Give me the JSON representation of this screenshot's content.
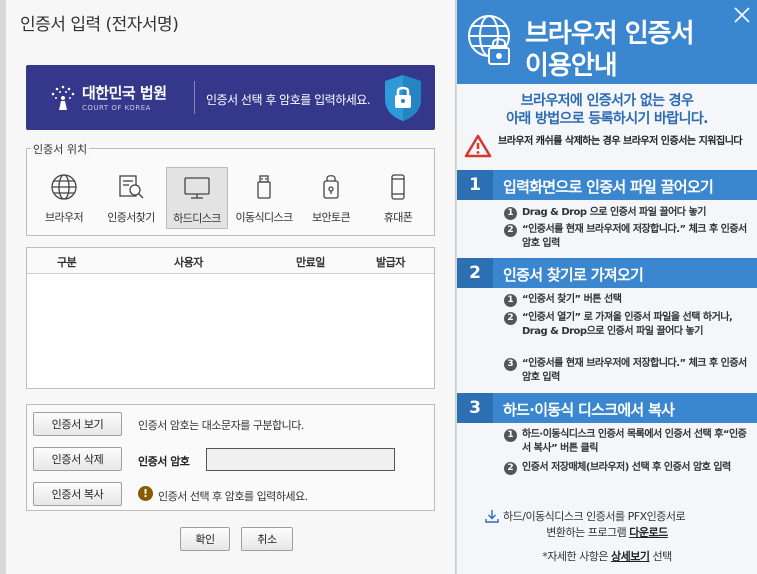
{
  "dialog": {
    "title": "인증서 입력 (전자서명)",
    "banner": {
      "org_name": "대한민국 법원",
      "org_en": "COURT OF KOREA",
      "message": "인증서 선택 후 암호를 입력하세요."
    },
    "location": {
      "legend": "인증서 위치",
      "items": [
        {
          "label": "브라우저",
          "icon": "globe-icon"
        },
        {
          "label": "인증서찾기",
          "icon": "certificate-search-icon"
        },
        {
          "label": "하드디스크",
          "icon": "monitor-icon",
          "selected": true
        },
        {
          "label": "이동식디스크",
          "icon": "usb-icon"
        },
        {
          "label": "보안토큰",
          "icon": "security-token-icon"
        },
        {
          "label": "휴대폰",
          "icon": "mobile-phone-icon"
        }
      ]
    },
    "table": {
      "headers": [
        "구분",
        "사용자",
        "만료일",
        "발급자"
      ]
    },
    "controls": {
      "view_button": "인증서 보기",
      "delete_button": "인증서 삭제",
      "copy_button": "인증서 복사",
      "case_note": "인증서 암호는 대소문자를 구분합니다.",
      "password_label": "인증서 암호",
      "password_value": "",
      "warning_icon": "!",
      "warning_note": "인증서 선택 후 암호를 입력하세요."
    },
    "ok_button": "확인",
    "cancel_button": "취소"
  },
  "panel": {
    "title_line1": "브라우저 인증서",
    "title_line2": "이용안내",
    "intro_line1": "브라우저에 인증서가 없는 경우",
    "intro_line2": "아래 방법으로 등록하시기 바랍니다.",
    "cache_note": "브라우저 캐쉬를 삭제하는 경우 브라우저 인증서는 지워집니다",
    "sections": [
      {
        "num": "1",
        "title": "입력화면으로 인증서 파일 끌어오기",
        "steps": [
          {
            "badge": "1",
            "text": "Drag & Drop 으로 인증서 파일 끌어다 놓기"
          },
          {
            "badge": "2",
            "text": "“인증서를 현재 브라우저에 저장합니다.” 체크 후 인증서 암호 입력"
          }
        ]
      },
      {
        "num": "2",
        "title": "인증서 찾기로 가져오기",
        "steps": [
          {
            "badge": "1",
            "text": "“인증서 찾기” 버튼 선택"
          },
          {
            "badge": "2",
            "text": "“인증서 열기” 로 가져올 인증서 파일을 선택 하거나, Drag & Drop으로 인증서 파일 끌어다 놓기"
          },
          {
            "badge": "3",
            "text": "“인증서를 현재 브라우저에 저장합니다.” 체크 후 인증서 암호 입력"
          }
        ]
      },
      {
        "num": "3",
        "title": "하드·이동식 디스크에서 복사",
        "steps": [
          {
            "badge": "1",
            "text": "하드·이동식디스크 인증서 목록에서 인증서 선택 후“인증서 복사” 버튼 클릭"
          },
          {
            "badge": "2",
            "text": "인증서 저장매체(브라우저) 선택 후 인증서 암호 입력"
          }
        ]
      }
    ],
    "download_line1": "하드/이동식디스크 인증서를 PFX인증서로",
    "download_line2_prefix": "변환하는 프로그램",
    "download_link": "다운로드",
    "more_prefix": "*자세한 사항은",
    "more_link": "상세보기",
    "more_suffix": "선택",
    "colors": {
      "accent": "#3a86cf",
      "section_num": "#2d6fb3",
      "banner": "#34378a"
    }
  }
}
